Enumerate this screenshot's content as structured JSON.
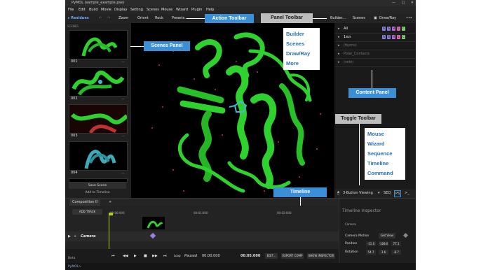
{
  "window": {
    "title": "PyMOL (sample_example.pse)",
    "controls": [
      "—",
      "□",
      "✕"
    ]
  },
  "menu": [
    "File",
    "Edit",
    "Build",
    "Movie",
    "Display",
    "Setting",
    "Scenes",
    "Mouse",
    "Wizard",
    "Plugin",
    "Help"
  ],
  "toolbar": {
    "selection_mode": "Residues",
    "zoom": "Zoom",
    "orient": "Orient",
    "rock": "Rock",
    "presets": "Presets...",
    "builder": "Builder...",
    "scenes": "Scenes",
    "draw_ray": "Draw/Ray",
    "more": "•••"
  },
  "scenes_panel": {
    "label": "SCENES",
    "thumbs": [
      {
        "num": "001",
        "dots": "..."
      },
      {
        "num": "002",
        "dots": "..."
      },
      {
        "num": "003",
        "dots": "..."
      },
      {
        "num": "004",
        "dots": "..."
      }
    ],
    "save_scene": "Save Scene",
    "add_timeline": "Add to Timeline"
  },
  "objects": [
    {
      "name": "All",
      "dim": false
    },
    {
      "name": "1ezr",
      "dim": false
    },
    {
      "name": "(fsyms)",
      "dim": true
    },
    {
      "name": "Polar_Contacts",
      "dim": true
    },
    {
      "name": "(sele)",
      "dim": true
    }
  ],
  "badges": [
    "A",
    "S",
    "H",
    "L",
    "C"
  ],
  "badge_colors": {
    "A": "#8a7ee0",
    "S": "#8a7ee0",
    "H": "#c06cd6",
    "L": "#d86fa8",
    "C": "#7ed36e"
  },
  "right_bottom": {
    "viewing": "3-Button Viewing",
    "seq": "SEQ",
    "ps": "PS"
  },
  "timeline": {
    "tab": "Composition 0",
    "add_tab": "+",
    "add_track": "ADD TRACK",
    "ruler": [
      "00:00:000",
      "00:01:000",
      "00:02:000"
    ],
    "camera_label": "Camera",
    "loop": "Loop",
    "paused": "Paused",
    "time_current": "00:00:000",
    "time_total": "00:05:000",
    "edit": "EDIT...",
    "export": "EXPORT COMP",
    "show_inspector": "SHOW INSPECTOR",
    "status": "Beta",
    "prompt": "PyMOL>"
  },
  "inspector": {
    "title": "Timeline Inspector",
    "section": "Camera",
    "camera_motion": "Camera Motion",
    "get_view": "Get View",
    "position_label": "Position",
    "position": [
      "-11.0",
      "-108.0",
      "77.1"
    ],
    "rotation_label": "Rotation",
    "rotation": [
      "54.7",
      "3.6",
      "-8.7"
    ]
  },
  "callouts": {
    "action_toolbar": "Action Toolbar",
    "panel_toolbar": "Panel Toolbar",
    "scenes_panel": "Scenes Panel",
    "content_panel": "Content Panel",
    "toggle_toolbar": "Toggle Toolbar",
    "timeline": "Timeline"
  },
  "popup_panel": [
    "Builder",
    "Scenes",
    "Draw/Ray",
    "More"
  ],
  "popup_toggle": [
    "Mouse",
    "Wizard",
    "Sequence",
    "Timeline",
    "Command"
  ],
  "colors": {
    "accent": "#3a8fd6",
    "protein": "#2fd12f",
    "ligand": "#45b7d6"
  }
}
